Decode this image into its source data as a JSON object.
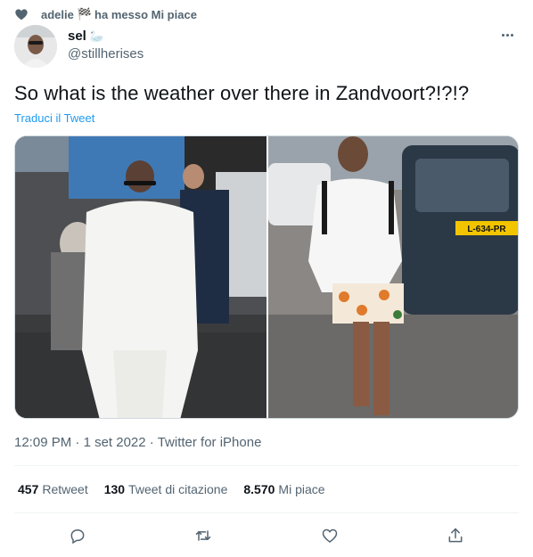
{
  "social_context": {
    "user": "adelie",
    "flag": "🏁",
    "action": "ha messo Mi piace"
  },
  "author": {
    "display_name": "sel",
    "emoji": "🦢",
    "handle": "@stillherises"
  },
  "tweet": {
    "text": "So what is the weather over there in Zandvoort?!?!?",
    "translate_label": "Traduci il Tweet"
  },
  "meta": {
    "time": "12:09 PM",
    "date": "1 set 2022",
    "source": "Twitter for iPhone",
    "separator": "·"
  },
  "stats": [
    {
      "count": "457",
      "label": "Retweet"
    },
    {
      "count": "130",
      "label": "Tweet di citazione"
    },
    {
      "count": "8.570",
      "label": "Mi piace"
    }
  ],
  "photo2_plate": "L-634-PR",
  "colors": {
    "accent": "#1d9bf0",
    "secondary_text": "#536471",
    "divider": "#eff3f4"
  },
  "icons": [
    "heart-icon",
    "more-icon",
    "reply-icon",
    "retweet-icon",
    "like-icon",
    "share-icon"
  ]
}
